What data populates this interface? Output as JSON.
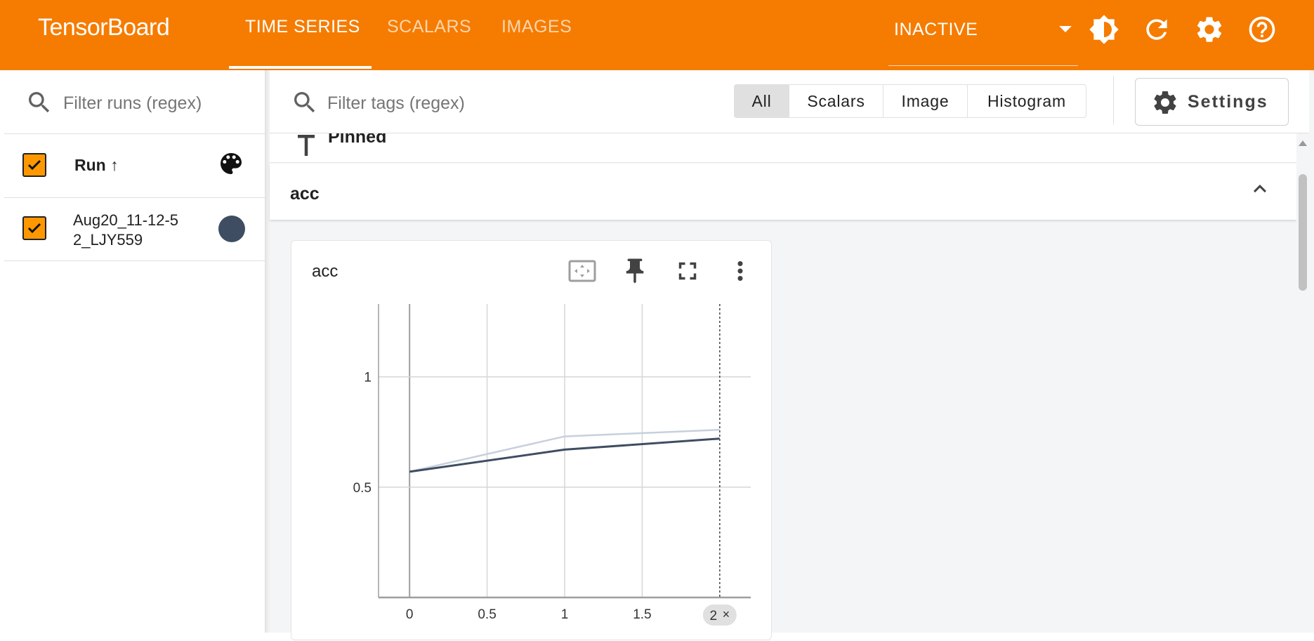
{
  "app": {
    "title": "TensorBoard"
  },
  "nav": {
    "tabs": [
      {
        "label": "TIME SERIES",
        "active": true
      },
      {
        "label": "SCALARS",
        "active": false
      },
      {
        "label": "IMAGES",
        "active": false
      }
    ],
    "reload_status": "INACTIVE",
    "icons": [
      "dark-mode-icon",
      "refresh-icon",
      "settings-gear-icon",
      "help-icon"
    ]
  },
  "runs_panel": {
    "filter_placeholder": "Filter runs (regex)",
    "header_label": "Run ↑",
    "runs": [
      {
        "name": "Aug20_11-12-52_LJY559",
        "checked": true,
        "color": "#3f4d63"
      }
    ]
  },
  "toolbar": {
    "tag_filter_placeholder": "Filter tags (regex)",
    "type_filters": [
      {
        "label": "All",
        "active": true
      },
      {
        "label": "Scalars",
        "active": false
      },
      {
        "label": "Image",
        "active": false
      },
      {
        "label": "Histogram",
        "active": false
      }
    ],
    "settings_label": "Settings"
  },
  "pinned": {
    "label": "Pinned"
  },
  "group": {
    "title": "acc"
  },
  "card": {
    "title": "acc",
    "icons": [
      "fit-domain-icon",
      "pin-icon",
      "fullscreen-icon",
      "more-vert-icon"
    ]
  },
  "chart_data": {
    "type": "line",
    "title": "acc",
    "xlabel": "",
    "ylabel": "",
    "x_ticks": [
      "0",
      "0.5",
      "1",
      "1.5",
      "2"
    ],
    "y_ticks": [
      "0.5",
      "1"
    ],
    "xlim": [
      -0.2,
      2.2
    ],
    "ylim": [
      0.0,
      1.33
    ],
    "grid": true,
    "series": [
      {
        "role": "raw",
        "color": "#c7d0dc",
        "x": [
          0,
          1,
          2
        ],
        "y": [
          0.57,
          0.73,
          0.76
        ]
      },
      {
        "role": "smoothed",
        "color": "#3f4d63",
        "x": [
          0,
          1,
          2
        ],
        "y": [
          0.57,
          0.67,
          0.72
        ]
      }
    ],
    "hover_step": "2",
    "hover_step_marker": 2
  },
  "colors": {
    "header_orange": "#f57c00",
    "checkbox_orange": "#ff9800",
    "run_color": "#3f4d63",
    "background": "#f4f5f7"
  }
}
